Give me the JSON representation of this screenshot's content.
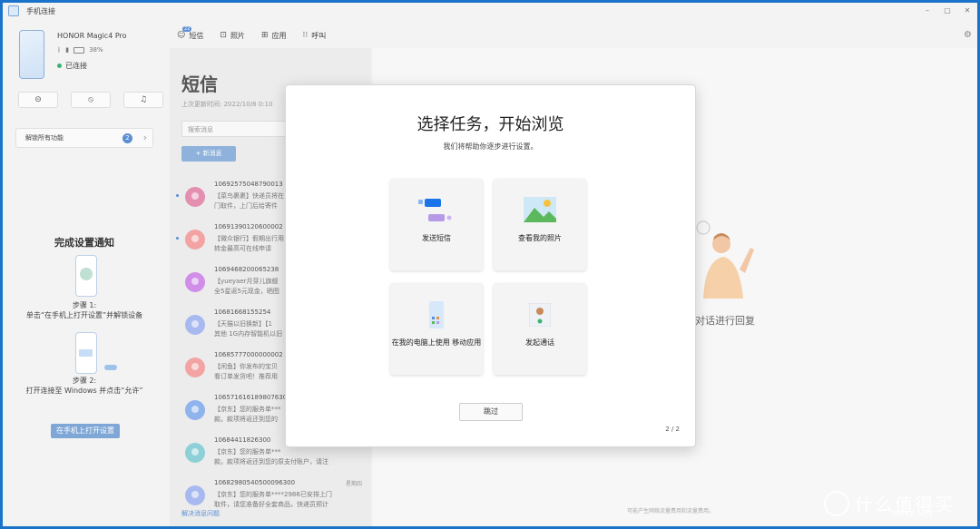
{
  "window": {
    "title": "手机连接",
    "controls": [
      "–",
      "▢",
      "✕"
    ]
  },
  "device": {
    "name": "HONOR Magic4 Pro",
    "battery": "38%",
    "status": "已连接"
  },
  "quick_actions": [
    "⊝",
    "⦸",
    "♫"
  ],
  "unlock": {
    "label": "解锁所有功能",
    "badge": "2",
    "chevron": "›"
  },
  "setup": {
    "title": "完成设置通知",
    "step1_label": "步骤 1:",
    "step1_text": "单击“在手机上打开设置”并解锁设备",
    "step2_label": "步骤 2:",
    "step2_text": "打开连接至 Windows 并点击“允许”",
    "button": "在手机上打开设置"
  },
  "tabs": [
    {
      "icon": "☺",
      "label": "短信",
      "count": "22"
    },
    {
      "icon": "⊡",
      "label": "照片"
    },
    {
      "icon": "⊞",
      "label": "应用"
    },
    {
      "icon": "⁝⁝",
      "label": "呼叫"
    }
  ],
  "messages_pane": {
    "title": "短信",
    "updated": "上次更新时间: 2022/10/8 0:10",
    "search_placeholder": "搜索消息",
    "new_button": "+   新消息",
    "footer": "解决消息问题",
    "items": [
      {
        "number": "10692575048790013",
        "line1": "【菜鸟裹裹】快递员将在",
        "line2": "门取件，上门后给寄件",
        "date": "",
        "color": "#e48fb0",
        "unread": true
      },
      {
        "number": "10691390120600002",
        "line1": "【微众银行】假期出行用",
        "line2": "转金最高可在线申请",
        "date": "",
        "color": "#f3a3a3",
        "unread": true
      },
      {
        "number": "1069468200065238",
        "line1": "【yueyaer月芽儿旗舰",
        "line2": "全5星返5元现金，晒图",
        "date": "",
        "color": "#d08ee8",
        "unread": false
      },
      {
        "number": "10681668155254",
        "line1": "【天猫以旧换新】【1",
        "line2": "其他 1G内存智能机以旧",
        "date": "",
        "color": "#a8b9ef",
        "unread": false
      },
      {
        "number": "10685777000000002",
        "line1": "【闲鱼】你发布的宝贝",
        "line2": "看订单发货吧！推荐用",
        "date": "",
        "color": "#f3a3a3",
        "unread": false
      },
      {
        "number": "10657161618980763001",
        "line1": "【京东】您的服务单***",
        "line2": "款。款项将返还到您的",
        "date": "",
        "color": "#8fb3ec",
        "unread": false
      },
      {
        "number": "10684411826300",
        "line1": "【京东】您的服务单***",
        "line2": "款。款项将返还到您的原支付账户，请注",
        "date": "",
        "color": "#8ed0d8",
        "unread": false
      },
      {
        "number": "10682980540500096300",
        "line1": "【京东】您的服务单****2986已安排上门",
        "line2": "取件，请您准备好全套商品，快递员预计",
        "date": "星期四",
        "color": "#a8b9ef",
        "unread": false
      }
    ]
  },
  "main_pane": {
    "hint": "对话进行回复",
    "footer": "可能产生网络流量费用和流量费用。"
  },
  "modal": {
    "title": "选择任务，开始浏览",
    "subtitle": "我们将帮助你逐步进行设置。",
    "cards": [
      {
        "label": "发送短信"
      },
      {
        "label": "查看我的照片"
      },
      {
        "label": "在我的电脑上使用 移动应用"
      },
      {
        "label": "发起通话"
      }
    ],
    "skip": "跳过",
    "pager": "2 / 2"
  },
  "watermark": {
    "text": "什么值得买",
    "sub": "SMYZ.NET"
  }
}
